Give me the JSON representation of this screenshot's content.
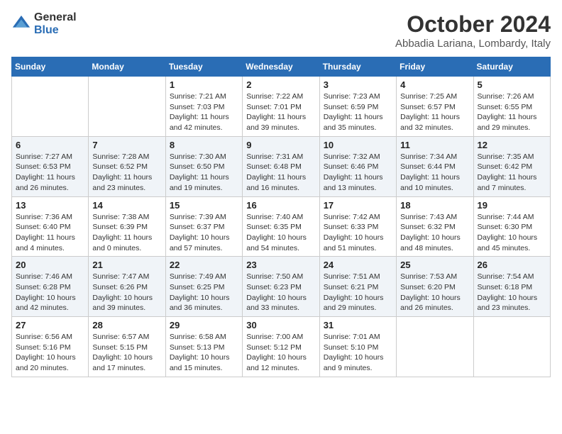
{
  "logo": {
    "general": "General",
    "blue": "Blue"
  },
  "title": "October 2024",
  "location": "Abbadia Lariana, Lombardy, Italy",
  "days_of_week": [
    "Sunday",
    "Monday",
    "Tuesday",
    "Wednesday",
    "Thursday",
    "Friday",
    "Saturday"
  ],
  "weeks": [
    [
      {
        "day": "",
        "info": ""
      },
      {
        "day": "",
        "info": ""
      },
      {
        "day": "1",
        "info": "Sunrise: 7:21 AM\nSunset: 7:03 PM\nDaylight: 11 hours and 42 minutes."
      },
      {
        "day": "2",
        "info": "Sunrise: 7:22 AM\nSunset: 7:01 PM\nDaylight: 11 hours and 39 minutes."
      },
      {
        "day": "3",
        "info": "Sunrise: 7:23 AM\nSunset: 6:59 PM\nDaylight: 11 hours and 35 minutes."
      },
      {
        "day": "4",
        "info": "Sunrise: 7:25 AM\nSunset: 6:57 PM\nDaylight: 11 hours and 32 minutes."
      },
      {
        "day": "5",
        "info": "Sunrise: 7:26 AM\nSunset: 6:55 PM\nDaylight: 11 hours and 29 minutes."
      }
    ],
    [
      {
        "day": "6",
        "info": "Sunrise: 7:27 AM\nSunset: 6:53 PM\nDaylight: 11 hours and 26 minutes."
      },
      {
        "day": "7",
        "info": "Sunrise: 7:28 AM\nSunset: 6:52 PM\nDaylight: 11 hours and 23 minutes."
      },
      {
        "day": "8",
        "info": "Sunrise: 7:30 AM\nSunset: 6:50 PM\nDaylight: 11 hours and 19 minutes."
      },
      {
        "day": "9",
        "info": "Sunrise: 7:31 AM\nSunset: 6:48 PM\nDaylight: 11 hours and 16 minutes."
      },
      {
        "day": "10",
        "info": "Sunrise: 7:32 AM\nSunset: 6:46 PM\nDaylight: 11 hours and 13 minutes."
      },
      {
        "day": "11",
        "info": "Sunrise: 7:34 AM\nSunset: 6:44 PM\nDaylight: 11 hours and 10 minutes."
      },
      {
        "day": "12",
        "info": "Sunrise: 7:35 AM\nSunset: 6:42 PM\nDaylight: 11 hours and 7 minutes."
      }
    ],
    [
      {
        "day": "13",
        "info": "Sunrise: 7:36 AM\nSunset: 6:40 PM\nDaylight: 11 hours and 4 minutes."
      },
      {
        "day": "14",
        "info": "Sunrise: 7:38 AM\nSunset: 6:39 PM\nDaylight: 11 hours and 0 minutes."
      },
      {
        "day": "15",
        "info": "Sunrise: 7:39 AM\nSunset: 6:37 PM\nDaylight: 10 hours and 57 minutes."
      },
      {
        "day": "16",
        "info": "Sunrise: 7:40 AM\nSunset: 6:35 PM\nDaylight: 10 hours and 54 minutes."
      },
      {
        "day": "17",
        "info": "Sunrise: 7:42 AM\nSunset: 6:33 PM\nDaylight: 10 hours and 51 minutes."
      },
      {
        "day": "18",
        "info": "Sunrise: 7:43 AM\nSunset: 6:32 PM\nDaylight: 10 hours and 48 minutes."
      },
      {
        "day": "19",
        "info": "Sunrise: 7:44 AM\nSunset: 6:30 PM\nDaylight: 10 hours and 45 minutes."
      }
    ],
    [
      {
        "day": "20",
        "info": "Sunrise: 7:46 AM\nSunset: 6:28 PM\nDaylight: 10 hours and 42 minutes."
      },
      {
        "day": "21",
        "info": "Sunrise: 7:47 AM\nSunset: 6:26 PM\nDaylight: 10 hours and 39 minutes."
      },
      {
        "day": "22",
        "info": "Sunrise: 7:49 AM\nSunset: 6:25 PM\nDaylight: 10 hours and 36 minutes."
      },
      {
        "day": "23",
        "info": "Sunrise: 7:50 AM\nSunset: 6:23 PM\nDaylight: 10 hours and 33 minutes."
      },
      {
        "day": "24",
        "info": "Sunrise: 7:51 AM\nSunset: 6:21 PM\nDaylight: 10 hours and 29 minutes."
      },
      {
        "day": "25",
        "info": "Sunrise: 7:53 AM\nSunset: 6:20 PM\nDaylight: 10 hours and 26 minutes."
      },
      {
        "day": "26",
        "info": "Sunrise: 7:54 AM\nSunset: 6:18 PM\nDaylight: 10 hours and 23 minutes."
      }
    ],
    [
      {
        "day": "27",
        "info": "Sunrise: 6:56 AM\nSunset: 5:16 PM\nDaylight: 10 hours and 20 minutes."
      },
      {
        "day": "28",
        "info": "Sunrise: 6:57 AM\nSunset: 5:15 PM\nDaylight: 10 hours and 17 minutes."
      },
      {
        "day": "29",
        "info": "Sunrise: 6:58 AM\nSunset: 5:13 PM\nDaylight: 10 hours and 15 minutes."
      },
      {
        "day": "30",
        "info": "Sunrise: 7:00 AM\nSunset: 5:12 PM\nDaylight: 10 hours and 12 minutes."
      },
      {
        "day": "31",
        "info": "Sunrise: 7:01 AM\nSunset: 5:10 PM\nDaylight: 10 hours and 9 minutes."
      },
      {
        "day": "",
        "info": ""
      },
      {
        "day": "",
        "info": ""
      }
    ]
  ]
}
